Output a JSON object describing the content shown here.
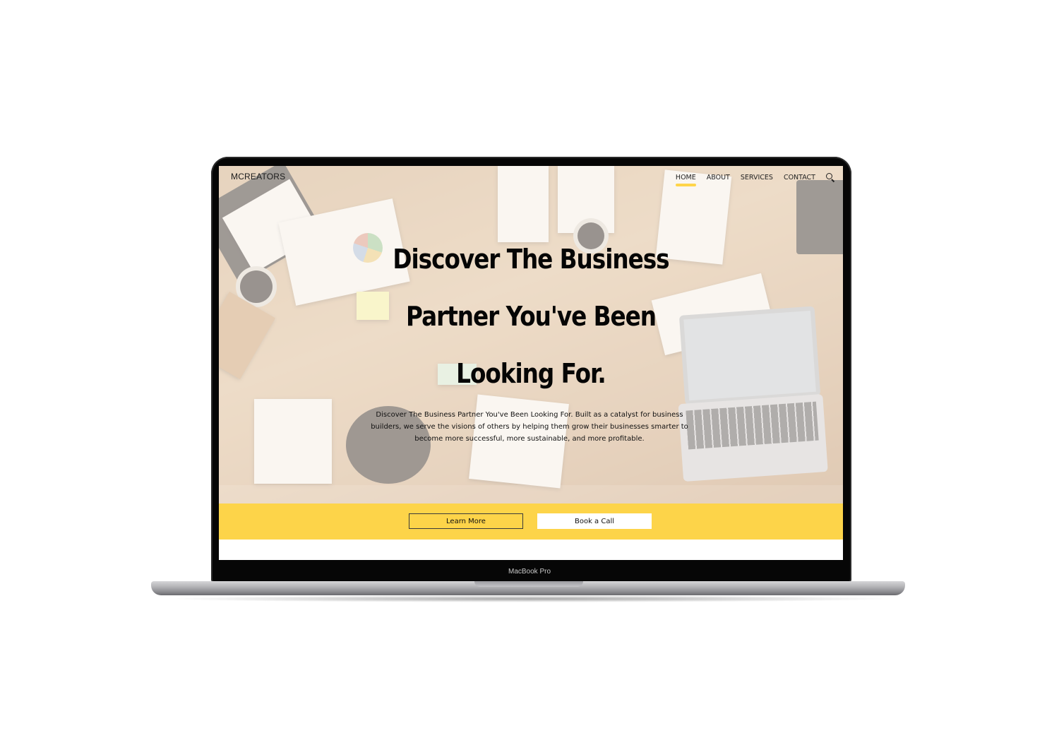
{
  "device": {
    "label": "MacBook Pro"
  },
  "site": {
    "brand": "MCREATORS",
    "nav": [
      {
        "label": "HOME",
        "active": true
      },
      {
        "label": "ABOUT",
        "active": false
      },
      {
        "label": "SERVICES",
        "active": false
      },
      {
        "label": "CONTACT",
        "active": false
      }
    ],
    "search_icon": "search-icon",
    "accent_color": "#fdd449"
  },
  "hero": {
    "headline_lines": [
      "Discover The Business",
      "Partner You've Been",
      "Looking For."
    ],
    "description": "Discover The Business Partner You've Been Looking For.  Built as a catalyst for business builders, we serve the visions of others by helping them grow their businesses smarter to become more successful, more sustainable, and more profitable."
  },
  "cta": {
    "learn_more": "Learn More",
    "book_call": "Book a Call"
  }
}
